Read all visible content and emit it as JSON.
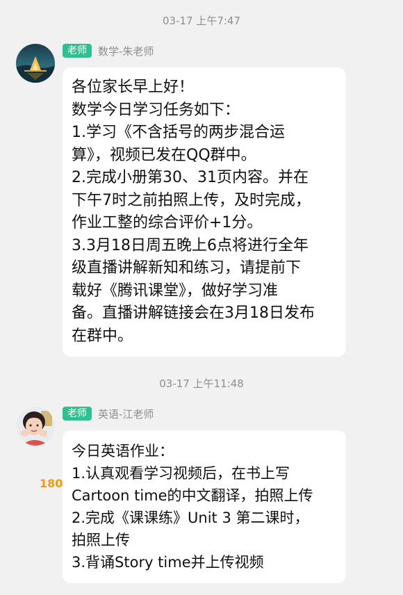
{
  "messages": [
    {
      "timestamp": "03-17 上午7:47",
      "role_badge": "老师",
      "sender": "数学-朱老师",
      "avatar": "night-lake-scenery-avatar",
      "lines": [
        "各位家长早上好！",
        "数学今日学习任务如下：",
        "1.学习《不含括号的两步混合运",
        "算》，视频已发在QQ群中。",
        "2.完成小册第30、31页内容。并在",
        "下午7时之前拍照上传，及时完成，",
        "作业工整的综合评价+1分。",
        "3.3月18日周五晚上6点将进行全年",
        "级直播讲解新知和练习，请提前下",
        "载好《腾讯课堂》，做好学习准",
        "备。直播讲解链接会在3月18日发布",
        "在群中。"
      ]
    },
    {
      "timestamp": "03-17 上午11:48",
      "role_badge": "老师",
      "sender": "英语-江老师",
      "avatar": "child-photo-avatar",
      "lines": [
        "今日英语作业：",
        "1.认真观看学习视频后，在书上写",
        "Cartoon time的中文翻译，拍照上传",
        "2.完成《课课练》Unit 3 第二课时，",
        "拍照上传",
        "3.背诵Story time并上传视频"
      ]
    }
  ],
  "page_number": "180",
  "colors": {
    "background": "#f1f1f1",
    "bubble": "#ffffff",
    "role_badge": "#2fbf91",
    "meta_text": "#8e8e8e",
    "page_number": "#f29a0e"
  }
}
